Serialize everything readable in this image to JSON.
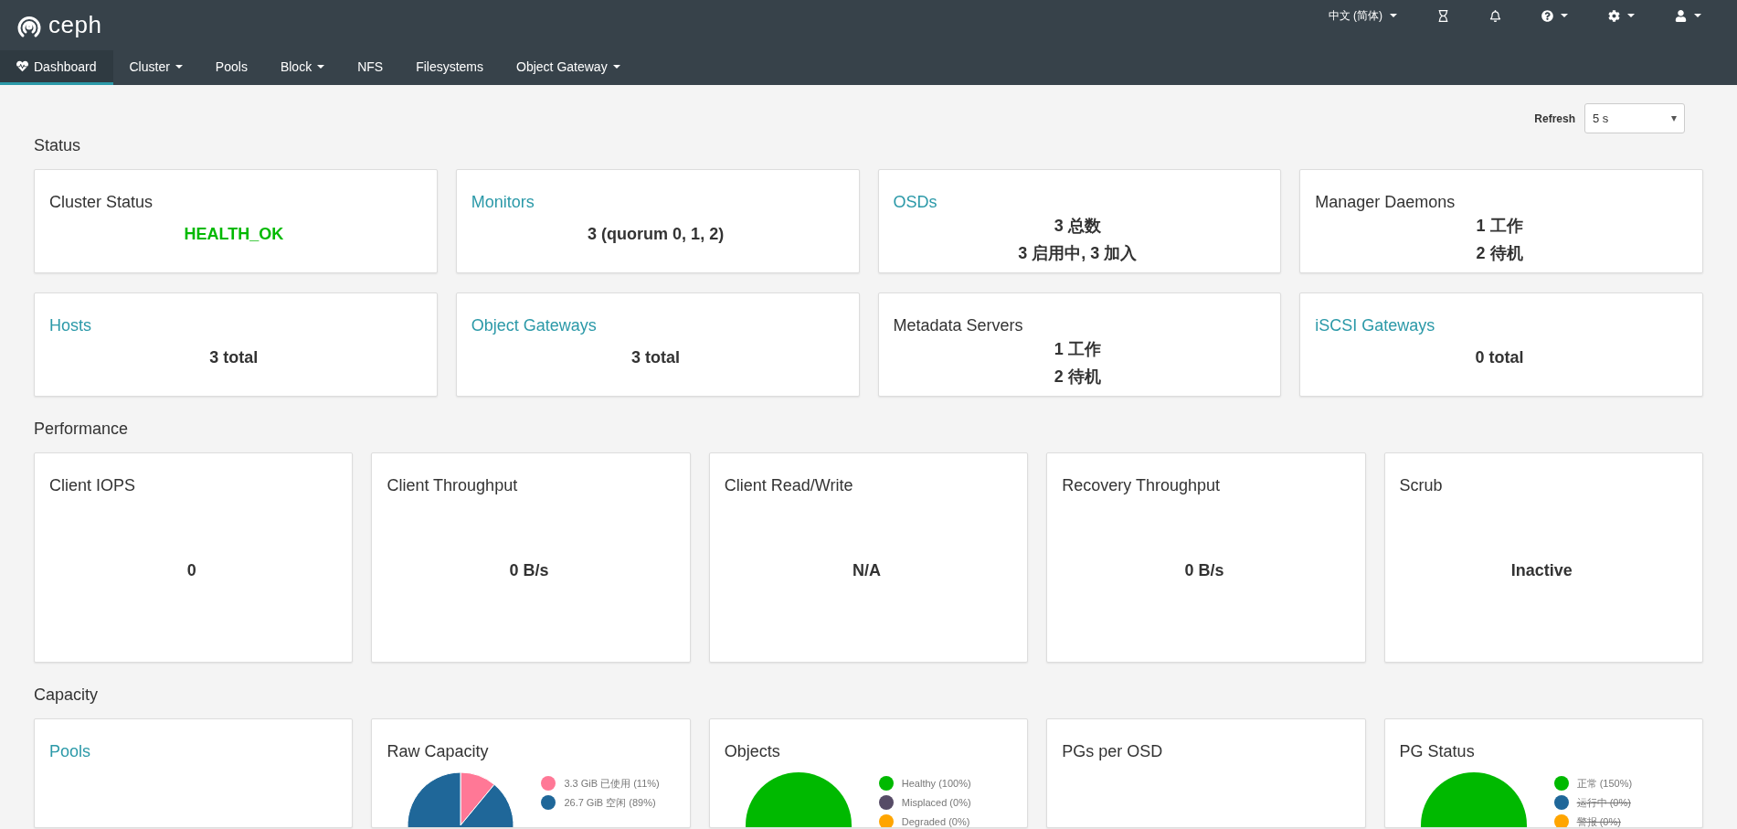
{
  "brand": "ceph",
  "nav": [
    {
      "label": "Dashboard",
      "selected": true,
      "has_menu": false,
      "kind": "icon_link"
    },
    {
      "label": "Cluster",
      "selected": false,
      "has_menu": true
    },
    {
      "label": "Pools",
      "selected": false,
      "has_menu": false
    },
    {
      "label": "Block",
      "selected": false,
      "has_menu": true
    },
    {
      "label": "NFS",
      "selected": false,
      "has_menu": false
    },
    {
      "label": "Filesystems",
      "selected": false,
      "has_menu": false
    },
    {
      "label": "Object Gateway",
      "selected": false,
      "has_menu": true
    }
  ],
  "top_right": {
    "language": "中文 (简体)",
    "icons": [
      {
        "kind": "tasks",
        "has_menu": false
      },
      {
        "kind": "notifications",
        "has_menu": false
      },
      {
        "kind": "help",
        "has_menu": true
      },
      {
        "kind": "settings",
        "has_menu": true
      },
      {
        "kind": "user",
        "has_menu": true
      }
    ]
  },
  "refresh": {
    "label": "Refresh",
    "value": "5 s"
  },
  "sections": [
    {
      "title": "Status",
      "cards": [
        {
          "title": "Cluster Status",
          "link": false,
          "color": "#00b900",
          "lines": [
            "HEALTH_OK"
          ]
        },
        {
          "title": "Monitors",
          "link": true,
          "lines": [
            "3 (quorum 0, 1, 2)"
          ]
        },
        {
          "title": "OSDs",
          "link": true,
          "lines": [
            "3 总数",
            "3 启用中, 3 加入"
          ]
        },
        {
          "title": "Manager Daemons",
          "link": false,
          "lines": [
            "1 工作",
            "2 待机"
          ]
        },
        {
          "title": "Hosts",
          "link": true,
          "lines": [
            "3 total"
          ]
        },
        {
          "title": "Object Gateways",
          "link": true,
          "lines": [
            "3 total"
          ]
        },
        {
          "title": "Metadata Servers",
          "link": false,
          "lines": [
            "1 工作",
            "2 待机"
          ]
        },
        {
          "title": "iSCSI Gateways",
          "link": true,
          "lines": [
            "0 total"
          ]
        }
      ]
    },
    {
      "title": "Performance",
      "cards": [
        {
          "title": "Client IOPS",
          "link": false,
          "lines": [
            "0"
          ]
        },
        {
          "title": "Client Throughput",
          "link": false,
          "lines": [
            "0 B/s"
          ]
        },
        {
          "title": "Client Read/Write",
          "link": false,
          "lines": [
            "N/A"
          ]
        },
        {
          "title": "Recovery Throughput",
          "link": false,
          "lines": [
            "0 B/s"
          ]
        },
        {
          "title": "Scrub",
          "link": false,
          "lines": [
            "Inactive"
          ]
        }
      ]
    },
    {
      "title": "Capacity",
      "cards": [
        {
          "title": "Pools",
          "link": true
        },
        {
          "title": "Raw Capacity",
          "link": false,
          "legend": [
            {
              "label": "3.3 GiB 已使用 (11%)",
              "color": "#ff7896",
              "hidden": false
            },
            {
              "label": "26.7 GiB 空闲 (89%)",
              "color": "#1f6799",
              "hidden": false
            }
          ],
          "chart_data": {
            "type": "pie",
            "values": [
              11,
              89
            ]
          }
        },
        {
          "title": "Objects",
          "link": false,
          "legend": [
            {
              "label": "Healthy (100%)",
              "color": "#00b900",
              "hidden": false
            },
            {
              "label": "Misplaced (0%)",
              "color": "#564b66",
              "hidden": false
            },
            {
              "label": "Degraded (0%)",
              "color": "#ffa500",
              "hidden": false
            }
          ],
          "chart_data": {
            "type": "pie",
            "values": [
              100,
              0,
              0
            ]
          }
        },
        {
          "title": "PGs per OSD",
          "link": false
        },
        {
          "title": "PG Status",
          "link": false,
          "legend": [
            {
              "label": "正常 (150%)",
              "color": "#00b900",
              "hidden": false
            },
            {
              "label": "运行中 (0%)",
              "color": "#1f6799",
              "hidden": true
            },
            {
              "label": "警报 (0%)",
              "color": "#ffa500",
              "hidden": true
            }
          ],
          "chart_data": {
            "type": "pie",
            "values": [
              100,
              0,
              0
            ]
          }
        }
      ]
    }
  ]
}
